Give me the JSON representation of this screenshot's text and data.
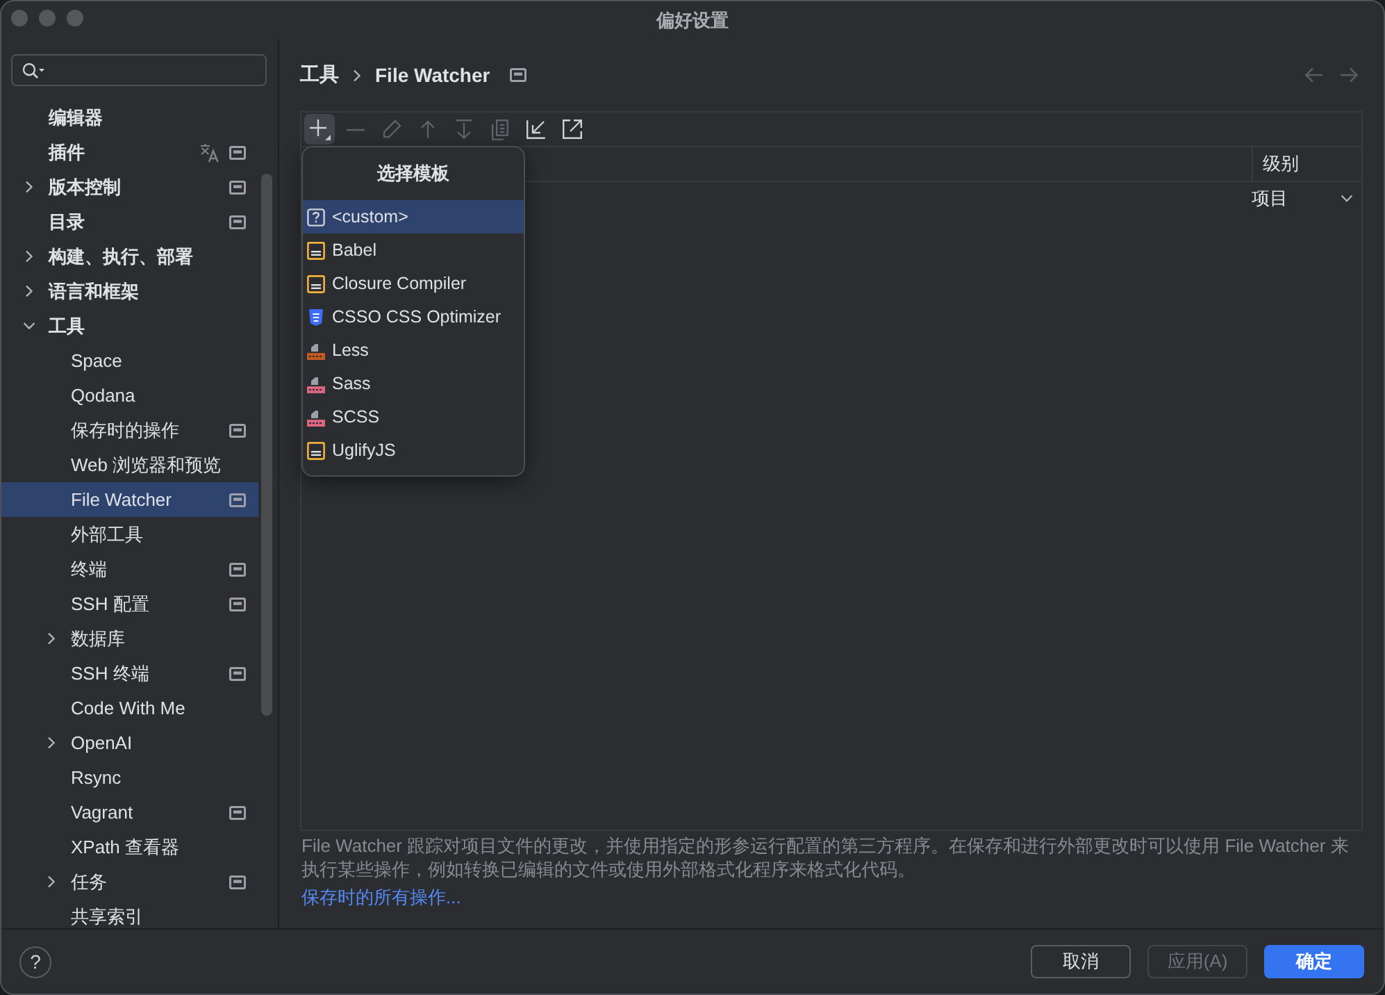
{
  "window": {
    "title": "偏好设置"
  },
  "sidebar": {
    "items": [
      {
        "label": "编辑器",
        "selected": false,
        "project_level": false,
        "translatable": false
      },
      {
        "label": "插件",
        "selected": false,
        "project_level": true,
        "translatable": true
      },
      {
        "label": "版本控制",
        "expanded": false,
        "selected": false,
        "project_level": true,
        "translatable": false
      },
      {
        "label": "目录",
        "selected": false,
        "project_level": true,
        "translatable": false
      },
      {
        "label": "构建、执行、部署",
        "expanded": false,
        "selected": false,
        "project_level": false,
        "translatable": false
      },
      {
        "label": "语言和框架",
        "expanded": false,
        "selected": false,
        "project_level": false,
        "translatable": false
      },
      {
        "label": "工具",
        "expanded": true,
        "selected": false,
        "project_level": false,
        "translatable": false,
        "children": [
          {
            "label": "Space",
            "selected": false,
            "project_level": false,
            "translatable": false
          },
          {
            "label": "Qodana",
            "selected": false,
            "project_level": false,
            "translatable": false
          },
          {
            "label": "保存时的操作",
            "selected": false,
            "project_level": true,
            "translatable": false
          },
          {
            "label": "Web 浏览器和预览",
            "selected": false,
            "project_level": false,
            "translatable": false
          },
          {
            "label": "File Watcher",
            "selected": true,
            "project_level": true,
            "translatable": false
          },
          {
            "label": "外部工具",
            "selected": false,
            "project_level": false,
            "translatable": false
          },
          {
            "label": "终端",
            "selected": false,
            "project_level": true,
            "translatable": false
          },
          {
            "label": "SSH 配置",
            "selected": false,
            "project_level": true,
            "translatable": false
          },
          {
            "label": "数据库",
            "expanded": false,
            "selected": false,
            "project_level": false,
            "translatable": false
          },
          {
            "label": "SSH 终端",
            "selected": false,
            "project_level": true,
            "translatable": false
          },
          {
            "label": "Code With Me",
            "selected": false,
            "project_level": false,
            "translatable": false
          },
          {
            "label": "OpenAI",
            "expanded": false,
            "selected": false,
            "project_level": false,
            "translatable": false
          },
          {
            "label": "Rsync",
            "selected": false,
            "project_level": false,
            "translatable": false
          },
          {
            "label": "Vagrant",
            "selected": false,
            "project_level": true,
            "translatable": false
          },
          {
            "label": "XPath 查看器",
            "selected": false,
            "project_level": false,
            "translatable": false
          },
          {
            "label": "任务",
            "expanded": false,
            "selected": false,
            "project_level": true,
            "translatable": false
          },
          {
            "label": "共享索引",
            "selected": false,
            "project_level": false,
            "translatable": false
          }
        ]
      }
    ]
  },
  "main": {
    "breadcrumb": [
      "工具",
      "File Watcher"
    ],
    "project_level": true,
    "back": {
      "disabled": true
    },
    "forward": {
      "disabled": true
    },
    "toolbar": [
      {
        "kind": "add",
        "disabled": false,
        "pressed": true
      },
      {
        "kind": "remove",
        "disabled": true,
        "pressed": false
      },
      {
        "kind": "edit",
        "disabled": true,
        "pressed": false
      },
      {
        "kind": "move_up",
        "disabled": true,
        "pressed": false
      },
      {
        "kind": "move_down",
        "disabled": true,
        "pressed": false
      },
      {
        "kind": "copy",
        "disabled": true,
        "pressed": false
      },
      {
        "kind": "import",
        "disabled": false,
        "pressed": false
      },
      {
        "kind": "export",
        "disabled": false,
        "pressed": false
      }
    ],
    "table": {
      "columns": [
        {
          "label": "级别"
        }
      ],
      "rows": [
        {
          "cells": [
            "项目"
          ]
        }
      ]
    },
    "popup": {
      "title": "选择模板",
      "items": [
        {
          "label": "<custom>",
          "kind": "unknown",
          "selected": true
        },
        {
          "label": "Babel",
          "kind": "js",
          "selected": false
        },
        {
          "label": "Closure Compiler",
          "kind": "js",
          "selected": false
        },
        {
          "label": "CSSO CSS Optimizer",
          "kind": "css",
          "selected": false
        },
        {
          "label": "Less",
          "kind": "less",
          "selected": false
        },
        {
          "label": "Sass",
          "kind": "sass",
          "selected": false
        },
        {
          "label": "SCSS",
          "kind": "sass",
          "selected": false
        },
        {
          "label": "UglifyJS",
          "kind": "js",
          "selected": false
        }
      ]
    },
    "description": "File Watcher 跟踪对项目文件的更改，并使用指定的形参运行配置的第三方程序。在保存和进行外部更改时可以使用 File Watcher 来执行某些操作，例如转换已编辑的文件或使用外部格式化程序来格式化代码。",
    "link": "保存时的所有操作..."
  },
  "footer": {
    "help": "?",
    "buttons": [
      {
        "label": "取消",
        "primary": false,
        "disabled": false
      },
      {
        "label": "应用(A)",
        "primary": false,
        "disabled": true
      },
      {
        "label": "确定",
        "primary": true,
        "disabled": false
      }
    ]
  }
}
